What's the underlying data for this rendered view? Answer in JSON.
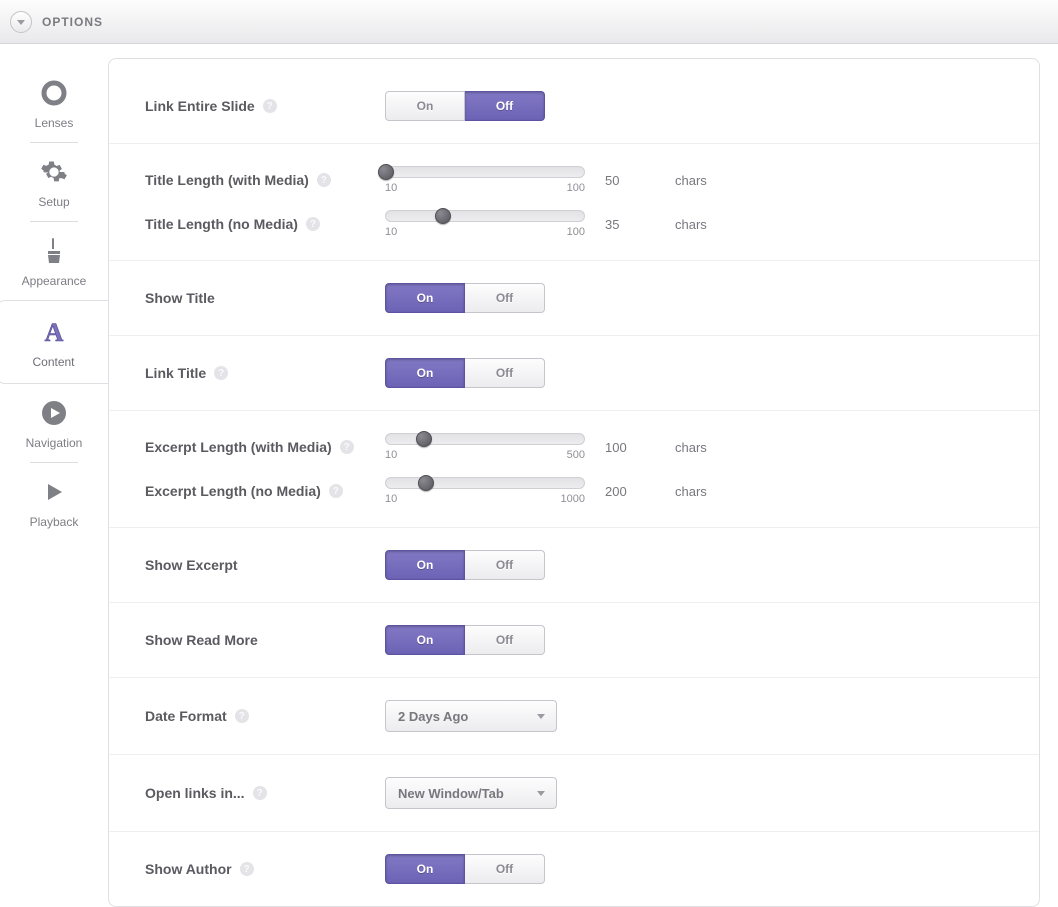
{
  "header": {
    "title": "OPTIONS"
  },
  "toggle": {
    "on": "On",
    "off": "Off"
  },
  "sidebar": {
    "items": [
      {
        "label": "Lenses"
      },
      {
        "label": "Setup"
      },
      {
        "label": "Appearance"
      },
      {
        "label": "Content"
      },
      {
        "label": "Navigation"
      },
      {
        "label": "Playback"
      }
    ]
  },
  "rows": {
    "linkSlide": {
      "label": "Link Entire Slide",
      "active": "Off"
    },
    "titleLenMedia": {
      "label": "Title Length (with Media)",
      "min": "10",
      "max": "100",
      "value": "50",
      "unit": "chars"
    },
    "titleLenNoMedia": {
      "label": "Title Length (no Media)",
      "min": "10",
      "max": "100",
      "value": "35",
      "unit": "chars"
    },
    "showTitle": {
      "label": "Show Title",
      "active": "On"
    },
    "linkTitle": {
      "label": "Link Title",
      "active": "On"
    },
    "excLenMedia": {
      "label": "Excerpt Length (with Media)",
      "min": "10",
      "max": "500",
      "value": "100",
      "unit": "chars"
    },
    "excLenNoMedia": {
      "label": "Excerpt Length (no Media)",
      "min": "10",
      "max": "1000",
      "value": "200",
      "unit": "chars"
    },
    "showExcerpt": {
      "label": "Show Excerpt",
      "active": "On"
    },
    "showReadMore": {
      "label": "Show Read More",
      "active": "On"
    },
    "dateFormat": {
      "label": "Date Format",
      "value": "2 Days Ago"
    },
    "openLinks": {
      "label": "Open links in...",
      "value": "New Window/Tab"
    },
    "showAuthor": {
      "label": "Show Author",
      "active": "On"
    }
  },
  "sliderPos": {
    "titleLenMedia": "45%",
    "titleLenNoMedia": "29%",
    "excLenMedia": "19%",
    "excLenNoMedia": "20%"
  }
}
